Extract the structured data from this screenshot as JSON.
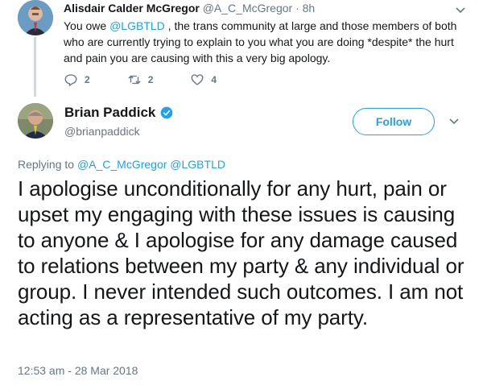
{
  "parent_tweet": {
    "author_name": "Alisdair Calder McGregor",
    "handle": "@A_C_McGregor",
    "time": "· 8h",
    "text_prefix": "You owe ",
    "mention": "@LGBTLD",
    "text_suffix": " , the trans community at large and those members of both who are currently trying to explain to you what you are doing *despite* the hurt and pain you are causing with this a very big apology.",
    "reply_count": "2",
    "retweet_count": "2",
    "like_count": "4"
  },
  "main_tweet": {
    "author_name": "Brian Paddick",
    "handle": "@brianpaddick",
    "follow_label": "Follow",
    "replying_prefix": "Replying to ",
    "replying_to_1": "@A_C_McGregor",
    "replying_to_2": "@LGBTLD",
    "text": "I apologise unconditionally for any hurt, pain or upset my engaging with these issues is causing to anyone & I apologise for any damage caused to relations between my party & any individual or group. I never intended such outcomes. I am not acting as a representative of my party.",
    "timestamp": "12:53 am - 28 Mar 2018"
  },
  "colors": {
    "accent": "#1da1f2",
    "secondary_text": "#657786",
    "primary_text": "#14171a"
  }
}
